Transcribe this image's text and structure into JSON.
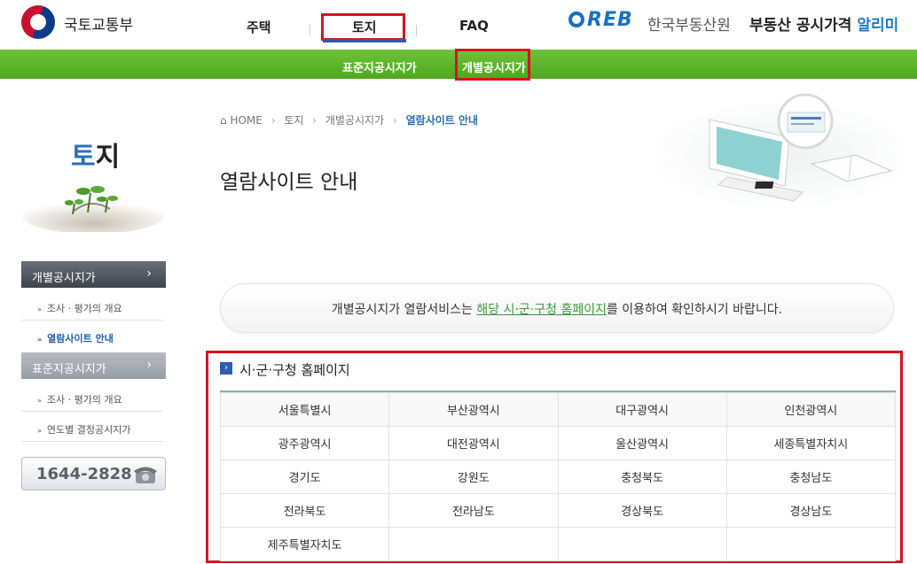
{
  "header": {
    "gov_name": "국토교통부",
    "nav": [
      "주택",
      "토지",
      "FAQ"
    ],
    "reb_logo": "REB",
    "reb_name": "한국부동산원",
    "site_title_main": "부동산 공시가격",
    "site_title_accent": "알리미"
  },
  "subnav": [
    "표준지공시지가",
    "개별공시지가"
  ],
  "sidebar": {
    "title_accent": "토",
    "title_rest": "지",
    "menu": [
      {
        "label": "개별공시지가",
        "arrow": "›"
      },
      {
        "label": "표준지공시지가",
        "arrow": "›"
      }
    ],
    "items": [
      "조사 · 평가의 개요",
      "열람사이트 안내",
      "조사 · 평가의 개요",
      "연도별 결정공시지가"
    ],
    "phone": "1644-2828"
  },
  "breadcrumb": {
    "home": "HOME",
    "items": [
      "토지",
      "개별공시지가"
    ],
    "current": "열람사이트 안내"
  },
  "page_title": "열람사이트 안내",
  "notice": {
    "before": "개별공시지가 열람서비스는 ",
    "highlight": "해당 시·군·구청 홈페이지",
    "after": "를 이용하여 확인하시기 바랍니다."
  },
  "section": {
    "title": "시·군·구청 홈페이지",
    "cities": [
      [
        "서울특별시",
        "부산광역시",
        "대구광역시",
        "인천광역시"
      ],
      [
        "광주광역시",
        "대전광역시",
        "울산광역시",
        "세종특별자치시"
      ],
      [
        "경기도",
        "강원도",
        "충청북도",
        "충청남도"
      ],
      [
        "전라북도",
        "전라남도",
        "경상북도",
        "경상남도"
      ],
      [
        "제주특별자치도",
        "",
        "",
        ""
      ]
    ]
  },
  "colors": {
    "accent_green": "#5cb82a",
    "accent_blue": "#2a6fb8",
    "highlight_red": "#d8121f"
  }
}
